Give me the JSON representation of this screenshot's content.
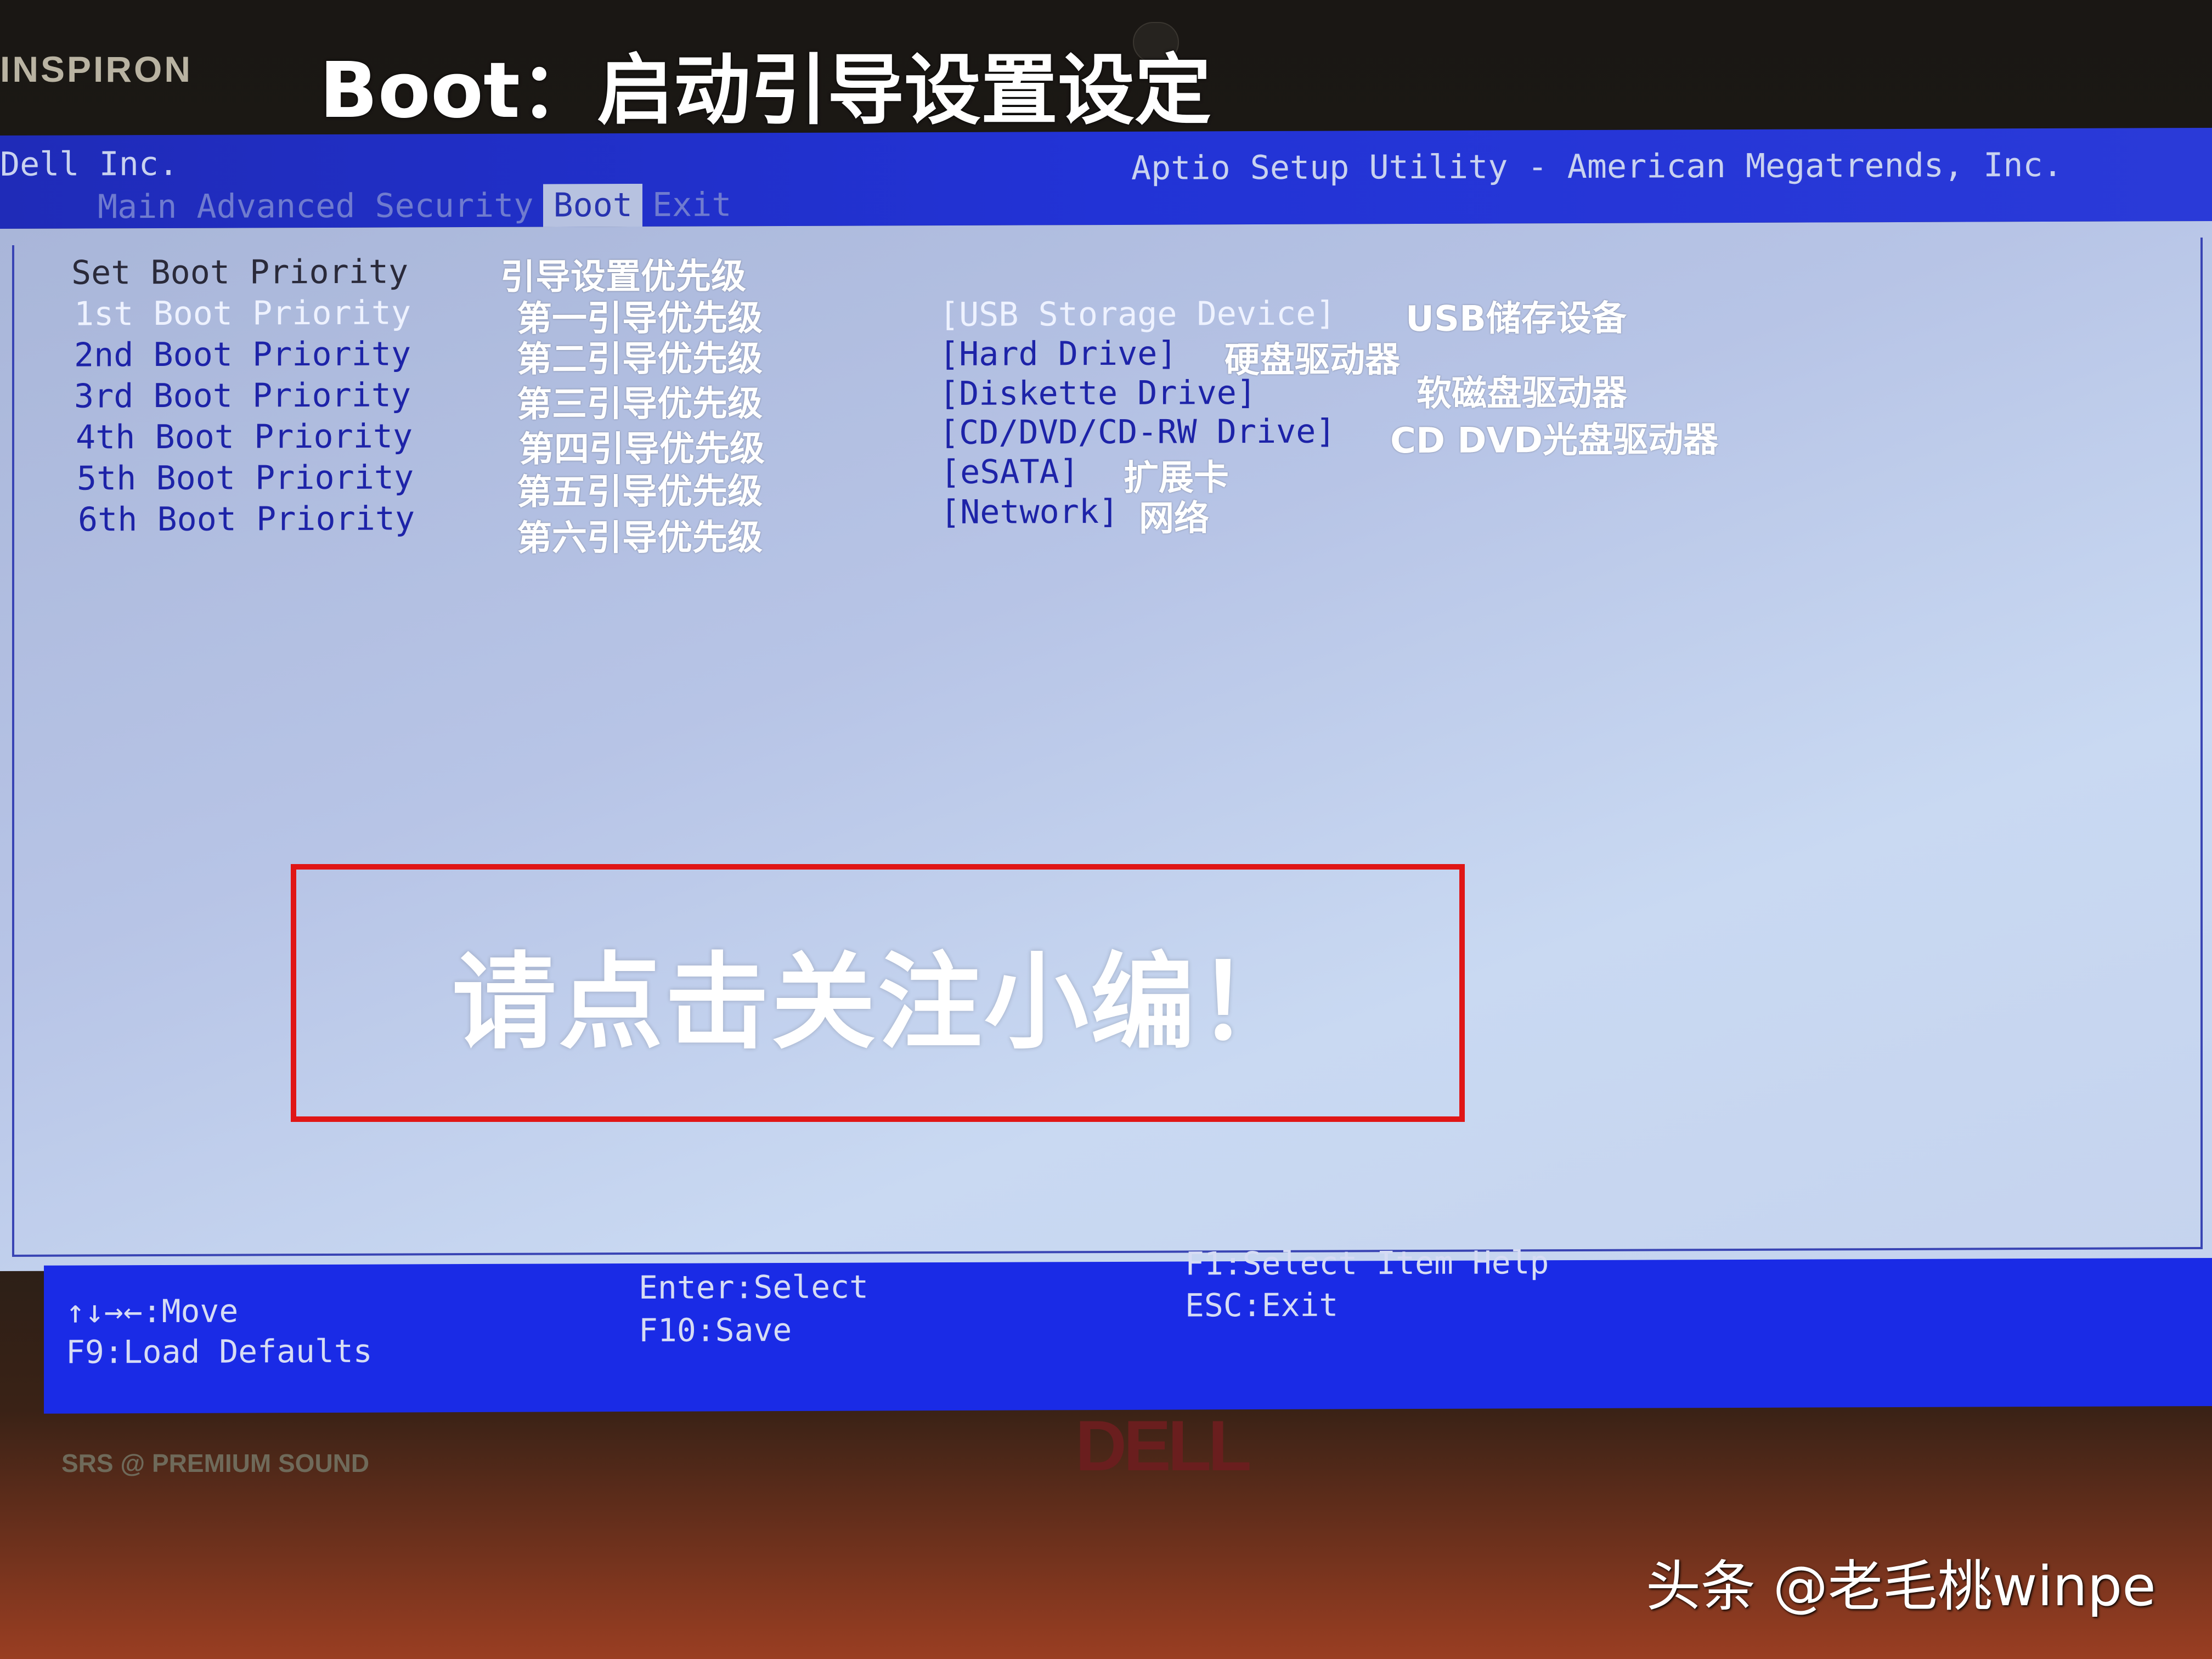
{
  "photo": {
    "bezel_brand": "INSPIRON",
    "overlay_title": "Boot：启动引导设置设定",
    "logo_text": "DELL",
    "speaker_label": "SRS @ PREMIUM SOUND",
    "watermark": "头条 @老毛桃winpe"
  },
  "bios": {
    "vendor": "Dell Inc.",
    "utility_title": "Aptio Setup Utility - American Megatrends, Inc.",
    "tabs": [
      {
        "label": "Main",
        "active": false
      },
      {
        "label": "Advanced",
        "active": false
      },
      {
        "label": "Security",
        "active": false
      },
      {
        "label": "Boot",
        "active": true
      },
      {
        "label": "Exit",
        "active": false
      }
    ],
    "section_header": {
      "label": "Set Boot Priority",
      "annotation": "引导设置优先级"
    },
    "priorities": [
      {
        "label": "1st Boot Priority",
        "annotation": "第一引导优先级",
        "value": "[USB Storage Device]",
        "value_annotation": "USB储存设备",
        "selected": true
      },
      {
        "label": "2nd Boot Priority",
        "annotation": "第二引导优先级",
        "value": "[Hard Drive]",
        "value_annotation": "硬盘驱动器",
        "selected": false
      },
      {
        "label": "3rd Boot Priority",
        "annotation": "第三引导优先级",
        "value": "[Diskette Drive]",
        "value_annotation": "软磁盘驱动器",
        "selected": false
      },
      {
        "label": "4th Boot Priority",
        "annotation": "第四引导优先级",
        "value": "[CD/DVD/CD-RW Drive]",
        "value_annotation": "CD DVD光盘驱动器",
        "selected": false
      },
      {
        "label": "5th Boot Priority",
        "annotation": "第五引导优先级",
        "value": "[eSATA]",
        "value_annotation": "扩展卡",
        "selected": false
      },
      {
        "label": "6th Boot Priority",
        "annotation": "第六引导优先级",
        "value": "[Network]",
        "value_annotation": "网络",
        "selected": false
      }
    ],
    "overlay_notice": "请点击关注小编！",
    "footer": {
      "move": "↑↓→←:Move",
      "load_defaults": "F9:Load Defaults",
      "enter": "Enter:Select",
      "save": "F10:Save",
      "help": "F1:Select Item Help",
      "exit": "ESC:Exit"
    }
  }
}
